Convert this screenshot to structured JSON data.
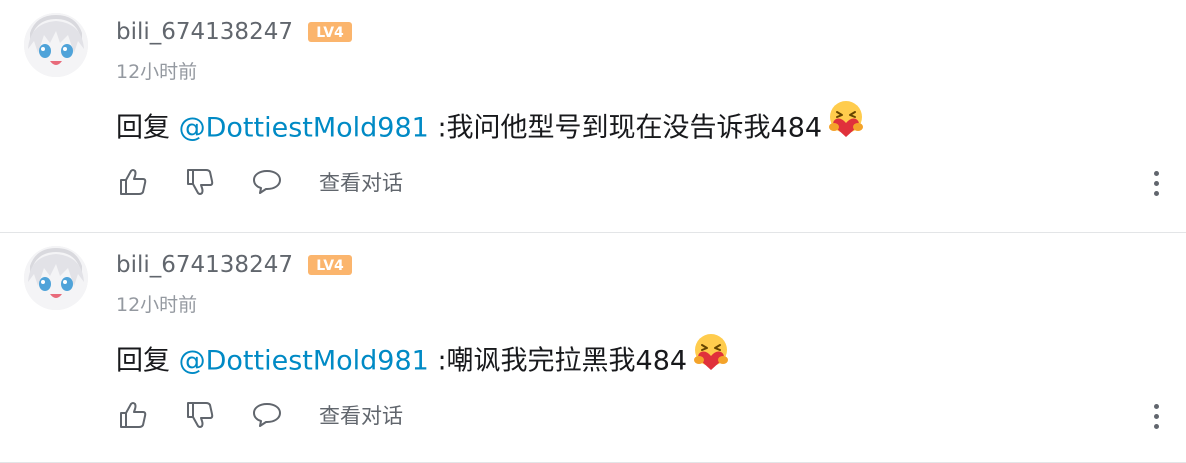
{
  "comments": [
    {
      "username": "bili_674138247",
      "level": "LV4",
      "time": "12小时前",
      "reply_prefix": "回复",
      "mention": "@DottiestMold981",
      "text": ":我问他型号到现在没告诉我484",
      "emoji": "hug-emoji",
      "view_conversation": "查看对话"
    },
    {
      "username": "bili_674138247",
      "level": "LV4",
      "time": "12小时前",
      "reply_prefix": "回复",
      "mention": "@DottiestMold981",
      "text": ":嘲讽我完拉黑我484",
      "emoji": "hug-emoji",
      "view_conversation": "查看对话"
    }
  ],
  "colors": {
    "mention": "#008ac5",
    "username": "#61666d",
    "time": "#9499a0",
    "level_badge": "#fbb56d",
    "divider": "#e3e5e7"
  }
}
